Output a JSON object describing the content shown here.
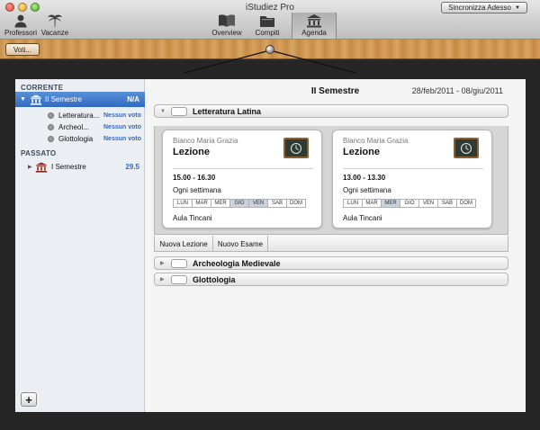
{
  "window": {
    "title": "iStudiez Pro",
    "sync_label": "Sincronizza Adesso"
  },
  "toolbar": {
    "professori": "Professori",
    "vacanze": "Vacanze",
    "overview": "Overview",
    "compiti": "Compiti",
    "agenda": "Agenda",
    "voti": "Voti..."
  },
  "sidebar": {
    "current_header": "CORRENTE",
    "past_header": "PASSATO",
    "current_semester": {
      "label": "II Semestre",
      "value": "N/A"
    },
    "courses": [
      {
        "name": "Letteratura...",
        "status": "Nessun voto"
      },
      {
        "name": "Archeol...",
        "status": "Nessun voto"
      },
      {
        "name": "Glottologia",
        "status": "Nessun voto"
      }
    ],
    "past_semester": {
      "label": "I Semestre",
      "value": "29.5"
    },
    "add_label": "+"
  },
  "main": {
    "semester_title": "II Semestre",
    "date_range": "28/feb/2011 - 08/giu/2011",
    "courses": [
      {
        "name": "Letteratura Latina"
      },
      {
        "name": "Archeologia Medievale"
      },
      {
        "name": "Glottologia"
      }
    ],
    "cards": [
      {
        "professor": "Bianco Maria Grazia",
        "kind": "Lezione",
        "time": "15.00 - 16.30",
        "frequency": "Ogni settimana",
        "days": [
          "LUN",
          "MAR",
          "MER",
          "GIO",
          "VEN",
          "SAB",
          "DOM"
        ],
        "active_days": [
          "GIO",
          "VEN"
        ],
        "room": "Aula Tincani"
      },
      {
        "professor": "Bianco Maria Grazia",
        "kind": "Lezione",
        "time": "13.00 - 13.30",
        "frequency": "Ogni settimana",
        "days": [
          "LUN",
          "MAR",
          "MER",
          "GIO",
          "VEN",
          "SAB",
          "DOM"
        ],
        "active_days": [
          "MER"
        ],
        "room": "Aula Tincani"
      }
    ],
    "new_lesson": "Nuova Lezione",
    "new_exam": "Nuovo Esame"
  },
  "colors": {
    "accent": "#2f6bc3",
    "wood": "#c9914e",
    "board": "#262626"
  },
  "icons": {
    "professori": "person-icon",
    "vacanze": "palm-tree-icon",
    "overview": "book-icon",
    "compiti": "folder-icon",
    "agenda": "building-icon",
    "card": "chalkboard-clock-icon"
  }
}
